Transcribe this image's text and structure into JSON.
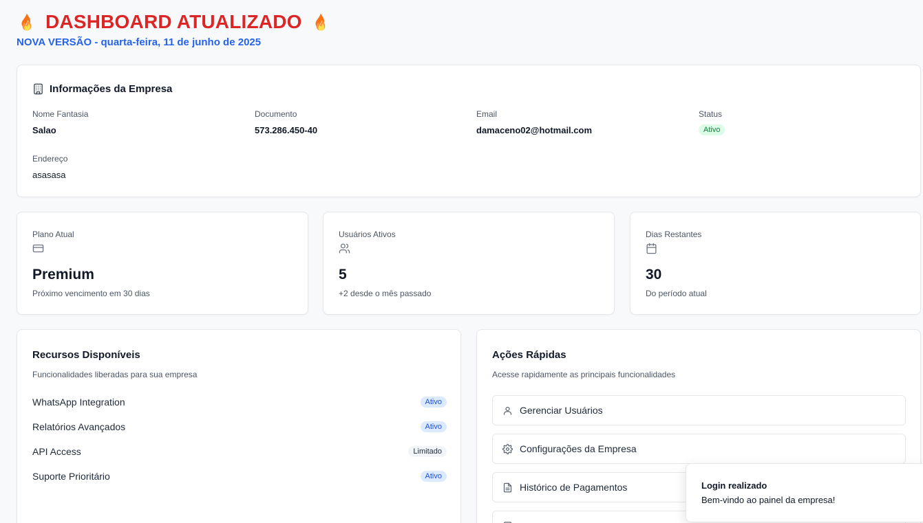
{
  "header": {
    "title": "DASHBOARD ATUALIZADO",
    "subtitle": "NOVA VERSÃO - quarta-feira, 11 de junho de 2025",
    "title_icon": "fire-icon"
  },
  "company": {
    "heading": "Informações da Empresa",
    "heading_icon": "building-icon",
    "fields": {
      "nome_label": "Nome Fantasia",
      "nome_value": "Salao",
      "documento_label": "Documento",
      "documento_value": "573.286.450-40",
      "email_label": "Email",
      "email_value": "damaceno02@hotmail.com",
      "status_label": "Status",
      "status_value": "Ativo",
      "endereco_label": "Endereço",
      "endereco_value": "asasasa"
    }
  },
  "stats": [
    {
      "label": "Plano Atual",
      "icon": "credit-card-icon",
      "value": "Premium",
      "desc": "Próximo vencimento em 30 dias"
    },
    {
      "label": "Usuários Ativos",
      "icon": "users-icon",
      "value": "5",
      "desc": "+2 desde o mês passado"
    },
    {
      "label": "Dias Restantes",
      "icon": "calendar-icon",
      "value": "30",
      "desc": "Do período atual"
    }
  ],
  "resources": {
    "title": "Recursos Disponíveis",
    "description": "Funcionalidades liberadas para sua empresa",
    "items": [
      {
        "name": "WhatsApp Integration",
        "status": "Ativo"
      },
      {
        "name": "Relatórios Avançados",
        "status": "Ativo"
      },
      {
        "name": "API Access",
        "status": "Limitado"
      },
      {
        "name": "Suporte Prioritário",
        "status": "Ativo"
      }
    ]
  },
  "actions": {
    "title": "Ações Rápidas",
    "description": "Acesse rapidamente as principais funcionalidades",
    "items": [
      {
        "label": "Gerenciar Usuários",
        "icon": "user-icon"
      },
      {
        "label": "Configurações da Empresa",
        "icon": "gear-icon"
      },
      {
        "label": "Histórico de Pagamentos",
        "icon": "file-icon"
      },
      {
        "label": "",
        "icon": "document-icon"
      }
    ]
  },
  "toast": {
    "title": "Login realizado",
    "message": "Bem-vindo ao painel da empresa!"
  },
  "colors": {
    "title_red": "#dc2626",
    "subtitle_blue": "#2563eb",
    "badge_green_bg": "#dcfce7",
    "badge_blue_bg": "#dbeafe"
  }
}
